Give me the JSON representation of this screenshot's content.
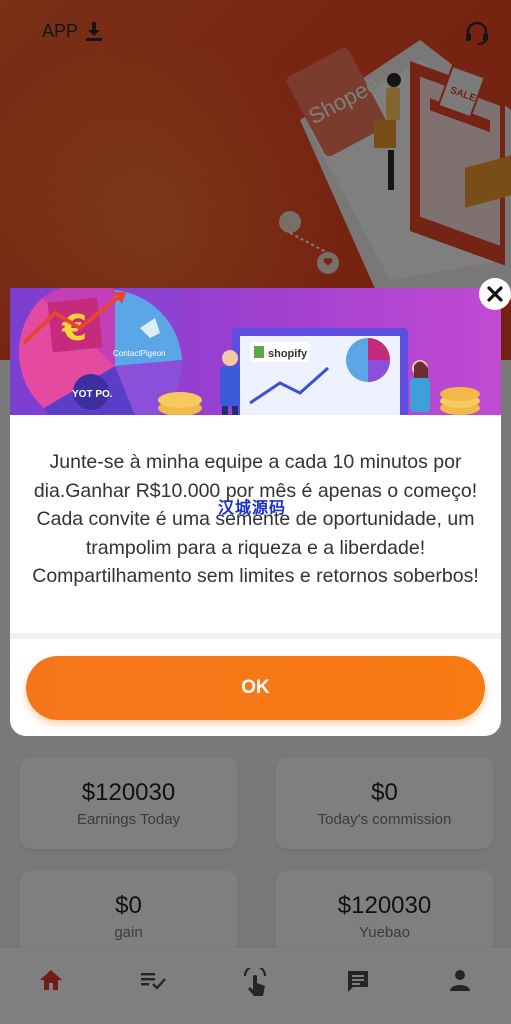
{
  "header": {
    "app_label": "APP",
    "download_icon": "download-icon",
    "support_icon": "customer-service-icon",
    "banner_brand": "Shopee",
    "banner_sale": "SALE"
  },
  "popup": {
    "banner_brand": "shopify",
    "banner_logo_1": "ContactPigeon",
    "banner_logo_2": "YOT PO.",
    "banner_currency": "€",
    "message": "Junte-se à minha equipe a cada 10 minutos por dia.Ganhar R$10.000 por mês é apenas o começo!  Cada convite é uma semente de oportunidade, um trampolim para a riqueza e a liberdade! Compartilhamento sem limites e retornos soberbos!",
    "watermark": "汉城源码",
    "ok_label": "OK",
    "close_icon": "close-icon"
  },
  "stats": [
    {
      "value": "$120030",
      "label": "Earnings Today"
    },
    {
      "value": "$0",
      "label": "Today's commission"
    },
    {
      "value": "$0",
      "label": "gain"
    },
    {
      "value": "$120030",
      "label": "Yuebao"
    }
  ],
  "tabbar": {
    "items": [
      {
        "icon": "home-icon",
        "active": true
      },
      {
        "icon": "task-list-icon",
        "active": false
      },
      {
        "icon": "tap-icon",
        "active": false
      },
      {
        "icon": "message-icon",
        "active": false
      },
      {
        "icon": "user-icon",
        "active": false
      }
    ]
  },
  "colors": {
    "brand_orange": "#ef4a24",
    "button_orange": "#f97b14",
    "tab_active": "#e53935",
    "banner_purple": "#9a3fd0"
  }
}
